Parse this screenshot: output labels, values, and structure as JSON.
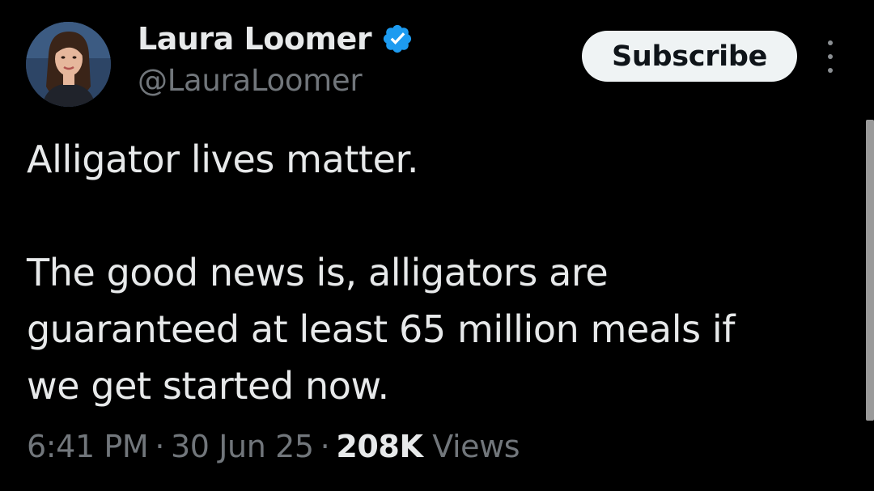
{
  "author": {
    "display_name": "Laura Loomer",
    "handle": "@LauraLoomer",
    "verified": true,
    "verified_icon": "verified-badge-icon",
    "avatar_icon": "avatar-photo"
  },
  "actions": {
    "subscribe_label": "Subscribe",
    "more_icon": "more-vertical-icon"
  },
  "tweet": {
    "lines": [
      "Alligator lives matter.",
      "",
      "The good news is, alligators are",
      "guaranteed at least 65 million meals if",
      "we get started now."
    ]
  },
  "meta": {
    "time": "6:41 PM",
    "separator": "·",
    "date": "30 Jun 25",
    "views_count": "208K",
    "views_label": "Views"
  },
  "colors": {
    "background": "#000000",
    "primary_text": "#e7e9ea",
    "secondary_text": "#71767b",
    "verified_blue": "#1d9bf0",
    "button_bg": "#eff3f4"
  }
}
